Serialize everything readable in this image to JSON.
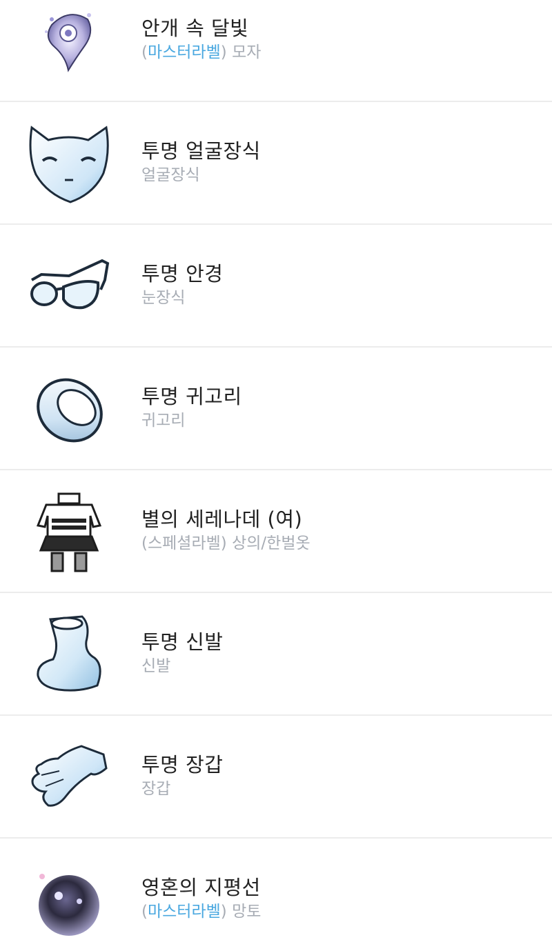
{
  "items": [
    {
      "name": "안개 속 달빛",
      "open": "(",
      "label": "마스터라벨",
      "close": ")",
      "category": " 모자",
      "icon": "moonlight-hat-icon"
    },
    {
      "name": "투명 얼굴장식",
      "open": "",
      "label": "",
      "close": "",
      "category": "얼굴장식",
      "icon": "mask-icon"
    },
    {
      "name": "투명 안경",
      "open": "",
      "label": "",
      "close": "",
      "category": "눈장식",
      "icon": "glasses-icon"
    },
    {
      "name": "투명 귀고리",
      "open": "",
      "label": "",
      "close": "",
      "category": "귀고리",
      "icon": "ring-earring-icon"
    },
    {
      "name": "별의 세레나데 (여)",
      "open": "(",
      "label": "스페셜라벨",
      "close": ")",
      "category": " 상의/한벌옷",
      "icon": "outfit-icon"
    },
    {
      "name": "투명 신발",
      "open": "",
      "label": "",
      "close": "",
      "category": "신발",
      "icon": "shoe-icon"
    },
    {
      "name": "투명 장갑",
      "open": "",
      "label": "",
      "close": "",
      "category": "장갑",
      "icon": "glove-icon"
    },
    {
      "name": "영혼의 지평선",
      "open": "(",
      "label": "마스터라벨",
      "close": ")",
      "category": " 망토",
      "icon": "soul-orb-icon"
    }
  ],
  "colors": {
    "master_label": "#4aa8e0",
    "special_label": "#a7acb4",
    "divider": "#ececec"
  }
}
